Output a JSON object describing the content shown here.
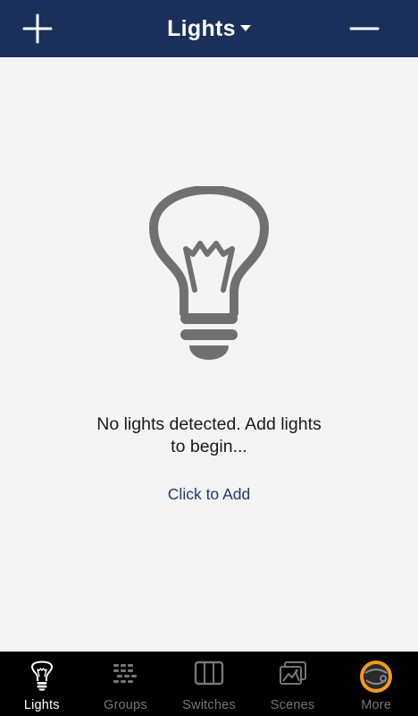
{
  "header": {
    "title": "Lights",
    "background": "#1b2f5b",
    "add_icon": "plus-icon",
    "remove_icon": "minus-icon",
    "dropdown_icon": "caret-down-icon"
  },
  "main": {
    "empty_icon": "lightbulb-icon",
    "empty_message_line1": "No lights detected. Add lights",
    "empty_message_line2": "to begin...",
    "add_link": "Click to Add",
    "link_color": "#1f3a6d"
  },
  "tabbar": {
    "active_tab": "Lights",
    "active_color": "#ffffff",
    "inactive_color": "#767676",
    "badge_color": "#f39a1f",
    "tabs": [
      {
        "label": "Lights",
        "icon": "lightbulb-icon"
      },
      {
        "label": "Groups",
        "icon": "groups-grid-icon"
      },
      {
        "label": "Switches",
        "icon": "switch-panel-icon"
      },
      {
        "label": "Scenes",
        "icon": "scenes-picture-icon"
      },
      {
        "label": "More",
        "icon": "more-circle-icon"
      }
    ]
  }
}
